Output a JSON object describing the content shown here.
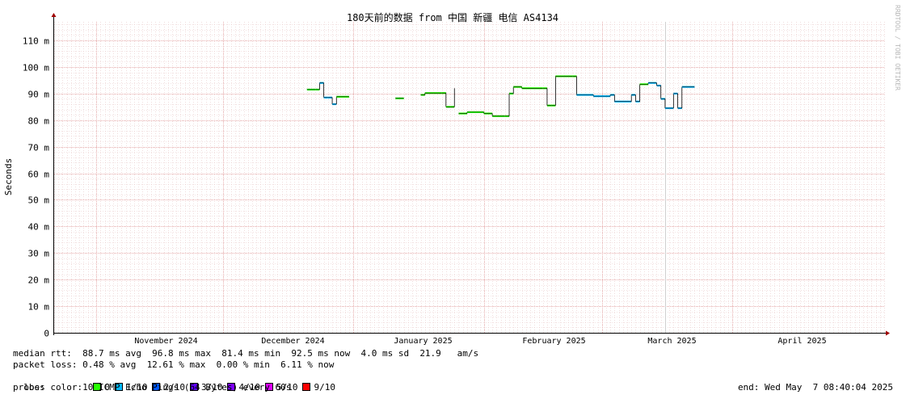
{
  "chart_data": {
    "type": "line",
    "title": "180天前的数据 from 中国 新疆 电信 AS4134",
    "ylabel": "Seconds",
    "watermark": "RRDTOOL / TOBI OETIKER",
    "ylim": [
      0,
      0.117
    ],
    "y_ticks": [
      {
        "value": 0,
        "label": "0"
      },
      {
        "value": 0.01,
        "label": "10 m"
      },
      {
        "value": 0.02,
        "label": "20 m"
      },
      {
        "value": 0.03,
        "label": "30 m"
      },
      {
        "value": 0.04,
        "label": "40 m"
      },
      {
        "value": 0.05,
        "label": "50 m"
      },
      {
        "value": 0.06,
        "label": "60 m"
      },
      {
        "value": 0.07,
        "label": "70 m"
      },
      {
        "value": 0.08,
        "label": "80 m"
      },
      {
        "value": 0.09,
        "label": "90 m"
      },
      {
        "value": 0.1,
        "label": "100 m"
      },
      {
        "value": 0.11,
        "label": "110 m"
      }
    ],
    "xlim": [
      "2024-10-22",
      "2025-05-07"
    ],
    "x_ticks": [
      {
        "date": "2024-11-01",
        "label": "November 2024"
      },
      {
        "date": "2024-12-01",
        "label": "December 2024"
      },
      {
        "date": "2025-01-01",
        "label": "January 2025"
      },
      {
        "date": "2025-02-01",
        "label": "February 2025"
      },
      {
        "date": "2025-03-01",
        "label": "March 2025"
      },
      {
        "date": "2025-04-01",
        "label": "April 2025"
      }
    ],
    "grid": true,
    "series": [
      {
        "name": "median rtt",
        "color_by_loss": true,
        "points": [
          [
            "2024-12-21",
            0.0915,
            0
          ],
          [
            "2024-12-23",
            0.0915,
            0
          ],
          [
            "2024-12-24",
            0.094,
            1
          ],
          [
            "2024-12-25",
            0.0885,
            1
          ],
          [
            "2024-12-26",
            0.0885,
            1
          ],
          [
            "2024-12-27",
            0.086,
            1
          ],
          [
            "2024-12-28",
            0.0888,
            0
          ],
          [
            "2024-12-31",
            0.0888,
            0
          ],
          null,
          [
            "2025-01-11",
            0.0882,
            0
          ],
          [
            "2025-01-13",
            0.0882,
            0
          ],
          null,
          [
            "2025-01-17",
            0.0895,
            0
          ],
          [
            "2025-01-18",
            0.0902,
            0
          ],
          [
            "2025-01-22",
            0.0902,
            0
          ],
          [
            "2025-01-23",
            0.085,
            0
          ],
          [
            "2025-01-24",
            0.085,
            0
          ],
          [
            "2025-01-25",
            0.092,
            0
          ],
          null,
          [
            "2025-01-26",
            0.0825,
            0
          ],
          [
            "2025-01-28",
            0.083,
            0
          ],
          [
            "2025-02-01",
            0.0825,
            0
          ],
          [
            "2025-02-03",
            0.0815,
            0
          ],
          [
            "2025-02-06",
            0.0815,
            0
          ],
          [
            "2025-02-07",
            0.09,
            0
          ],
          [
            "2025-02-08",
            0.0925,
            0
          ],
          [
            "2025-02-10",
            0.092,
            0
          ],
          [
            "2025-02-15",
            0.092,
            0
          ],
          [
            "2025-02-16",
            0.0855,
            0
          ],
          [
            "2025-02-17",
            0.0855,
            0
          ],
          [
            "2025-02-18",
            0.0965,
            0
          ],
          [
            "2025-02-22",
            0.0965,
            0
          ],
          [
            "2025-02-23",
            0.0895,
            1
          ],
          [
            "2025-02-27",
            0.089,
            1
          ],
          [
            "2025-03-03",
            0.0895,
            1
          ],
          [
            "2025-03-04",
            0.087,
            1
          ],
          [
            "2025-03-07",
            0.087,
            1
          ],
          [
            "2025-03-08",
            0.0895,
            1
          ],
          [
            "2025-03-09",
            0.087,
            1
          ],
          [
            "2025-03-10",
            0.0935,
            0
          ],
          [
            "2025-03-12",
            0.094,
            1
          ],
          [
            "2025-03-14",
            0.093,
            1
          ],
          [
            "2025-03-15",
            0.088,
            1
          ],
          [
            "2025-03-16",
            0.0845,
            1
          ],
          [
            "2025-03-17",
            0.0845,
            1
          ],
          [
            "2025-03-18",
            0.09,
            1
          ],
          [
            "2025-03-19",
            0.0845,
            1
          ],
          [
            "2025-03-20",
            0.0925,
            1
          ],
          [
            "2025-03-23",
            0.0925,
            1
          ]
        ]
      }
    ]
  },
  "stats": {
    "median_rtt": "median rtt:  88.7 ms avg  96.8 ms max  81.4 ms min  92.5 ms now  4.0 ms sd  21.9   am/s",
    "packet_loss": "packet loss: 0.48 % avg  12.61 % max  0.00 % min  6.11 % now",
    "loss_color_label": "loss color:",
    "loss_colors": [
      {
        "label": "0",
        "color": "#26ff00"
      },
      {
        "label": "1/10",
        "color": "#00b8ff"
      },
      {
        "label": "2/10",
        "color": "#0059ff"
      },
      {
        "label": "3/10",
        "color": "#5e00ff"
      },
      {
        "label": "4/10",
        "color": "#7e00ff"
      },
      {
        "label": "5/10",
        "color": "#dd00ff"
      },
      {
        "label": "9/10",
        "color": "#ff0000"
      }
    ],
    "probe": "probe:       10 ICMP Echo Pings (64 Bytes) every 60s",
    "end": "end: Wed May  7 08:40:04 2025"
  }
}
